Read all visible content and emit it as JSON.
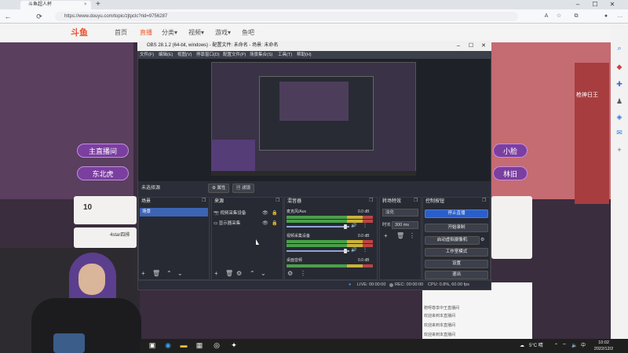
{
  "browser": {
    "tab_title": "斗鱼超人杯",
    "tab_close": "×",
    "new_tab": "+",
    "url": "https://www.douyu.com/topic/zjtpclc?rid=9756287",
    "nav": {
      "back": "←",
      "reload": "⟳"
    },
    "window_controls": {
      "minimize": "–",
      "maximize": "☐",
      "close": "✕"
    },
    "toolbar_icons": {
      "read": "A",
      "favorite": "☆",
      "collections": "⧉",
      "profile": "●",
      "more": "…"
    }
  },
  "site": {
    "logo": "斗鱼",
    "nav_items": [
      "首页",
      "直播",
      "分类▾",
      "视频▾",
      "游戏▾",
      "鱼吧"
    ],
    "active_nav": "直播",
    "left_buttons": [
      "主直播间",
      "东北虎"
    ],
    "right_buttons": [
      "小脸",
      "林旧"
    ],
    "card1": {
      "number": "10",
      "label": "4star四排"
    },
    "promo_right": "枪神日王",
    "chat_lines": [
      "赠呀尊享中王直播间",
      "欢迎来到本直播间",
      "欢迎来到本直播间",
      "欢迎来到本直播间"
    ]
  },
  "obs": {
    "title": "OBS 28.1.2 (64-bit, windows) - 配置文件: 未命名 - 场景: 未命名",
    "menu": [
      "文件(F)",
      "编辑(E)",
      "视图(V)",
      "停靠窗口(D)",
      "配置文件(P)",
      "场景集合(S)",
      "工具(T)",
      "帮助(H)"
    ],
    "source_bar": {
      "label": "未选择源",
      "properties": "属性",
      "filters": "滤镜"
    },
    "docks": {
      "scenes": {
        "title": "场景",
        "items": [
          "场景"
        ]
      },
      "sources": {
        "title": "来源",
        "items": [
          "视频采集设备",
          "显示器采集"
        ]
      },
      "mixer": {
        "title": "混音器",
        "channels": [
          {
            "name": "麦克风/Aux",
            "db": "0.0 dB"
          },
          {
            "name": "视频采集设备",
            "db": "0.0 dB"
          },
          {
            "name": "桌面音频",
            "db": "0.0 dB"
          }
        ]
      },
      "transitions": {
        "title": "转场特效",
        "select": "淡化",
        "duration_label": "时长",
        "duration": "300 ms"
      },
      "controls": {
        "title": "控制按钮",
        "buttons": [
          "停止直播",
          "开始录制",
          "启动虚拟摄像机",
          "工作室模式",
          "设置",
          "退出"
        ]
      }
    },
    "status": {
      "live": "LIVE: 00:00:00",
      "rec": "REC: 00:00:00",
      "cpu": "CPU: 0.8%, 60.00 fps"
    }
  },
  "taskbar": {
    "weather": "5°C 晴",
    "lang": "中",
    "time": "10:02",
    "date": "2022/12/2"
  }
}
